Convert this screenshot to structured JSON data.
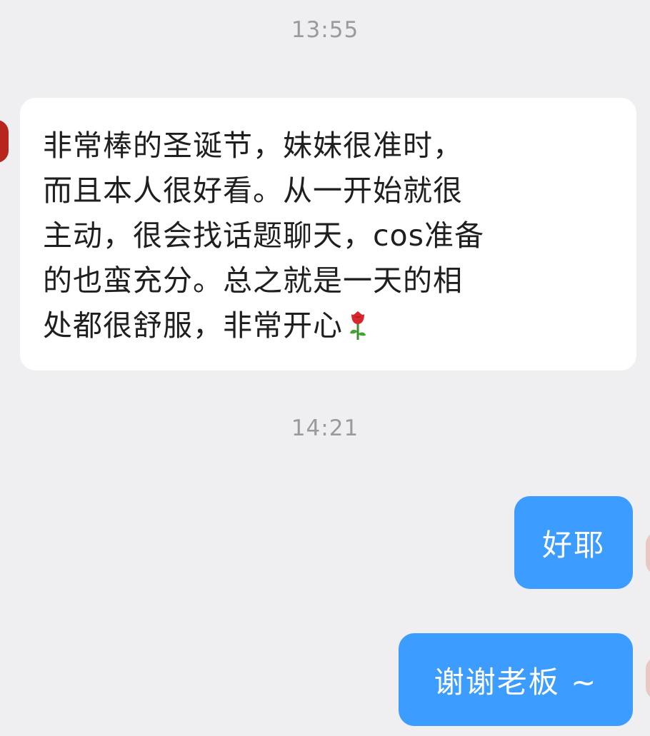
{
  "timestamps": [
    "13:55",
    "14:21"
  ],
  "messages": {
    "incoming": {
      "text": "非常棒的圣诞节，妹妹很准时，\n而且本人很好看。从一开始就很\n主动，很会找话题聊天，cos准备\n的也蛮充分。总之就是一天的相\n处都很舒服，非常开心",
      "emoji": "rose-icon"
    },
    "outgoing": [
      {
        "text": "好耶"
      },
      {
        "text": "谢谢老板 ~"
      }
    ]
  },
  "colors": {
    "background": "#efeff1",
    "incoming_bubble": "#ffffff",
    "outgoing_bubble": "#3d9cff",
    "timestamp": "#9a9a9c"
  }
}
